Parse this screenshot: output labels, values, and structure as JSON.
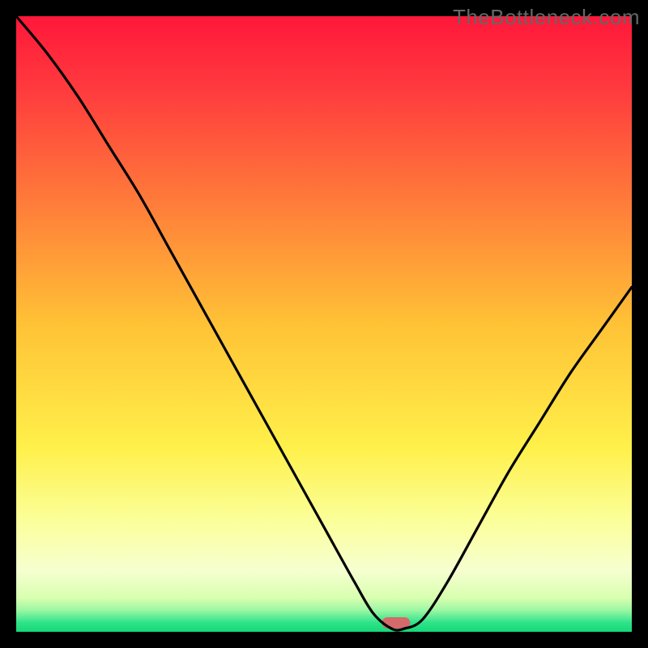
{
  "watermark": "TheBottleneck.com",
  "chart_data": {
    "type": "line",
    "title": "",
    "xlabel": "",
    "ylabel": "",
    "x_range": [
      0,
      100
    ],
    "y_range": [
      0,
      100
    ],
    "curve": {
      "name": "bottleneck-curve",
      "x": [
        0,
        5,
        10,
        15,
        20,
        25,
        30,
        35,
        40,
        45,
        50,
        55,
        58,
        61,
        63,
        66,
        70,
        75,
        80,
        85,
        90,
        95,
        100
      ],
      "values": [
        100,
        94,
        87,
        79,
        71,
        62,
        53,
        44,
        35,
        26,
        17,
        8,
        3,
        0.5,
        0.5,
        2,
        8,
        17,
        26,
        34,
        42,
        49,
        56
      ]
    },
    "flat_region_x": [
      59,
      65
    ],
    "optimum_marker": {
      "x_center": 61.7,
      "width": 4.6,
      "color": "#d46a6a"
    },
    "gradient_stops": [
      {
        "pos": 0.0,
        "color": "#ff173a"
      },
      {
        "pos": 0.12,
        "color": "#ff3b3e"
      },
      {
        "pos": 0.3,
        "color": "#ff7b3a"
      },
      {
        "pos": 0.5,
        "color": "#ffc236"
      },
      {
        "pos": 0.7,
        "color": "#fff04a"
      },
      {
        "pos": 0.82,
        "color": "#fbff9a"
      },
      {
        "pos": 0.9,
        "color": "#f6ffd0"
      },
      {
        "pos": 0.945,
        "color": "#d8ffb0"
      },
      {
        "pos": 0.965,
        "color": "#9bf7a3"
      },
      {
        "pos": 0.985,
        "color": "#2fe38a"
      },
      {
        "pos": 1.0,
        "color": "#16d878"
      }
    ]
  }
}
